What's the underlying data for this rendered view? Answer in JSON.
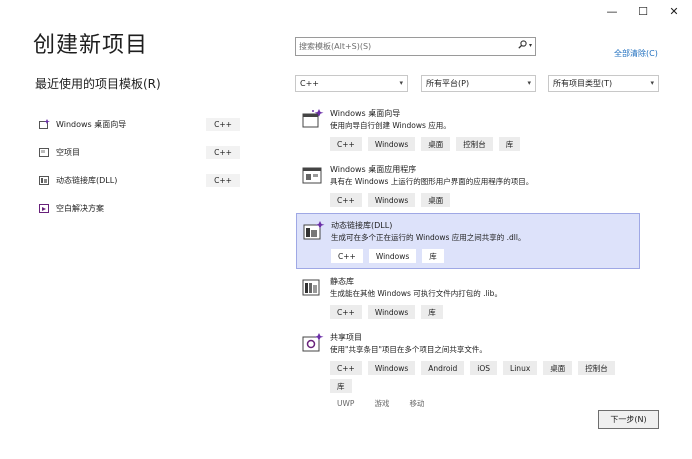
{
  "window": {
    "minimize": "—",
    "maximize": "☐",
    "close": "✕"
  },
  "page_title": "创建新项目",
  "recent": {
    "title": "最近使用的项目模板(R)",
    "items": [
      {
        "label": "Windows 桌面向导",
        "lang": "C++",
        "icon": "wizard-icon"
      },
      {
        "label": "空项目",
        "lang": "C++",
        "icon": "empty-project-icon"
      },
      {
        "label": "动态链接库(DLL)",
        "lang": "C++",
        "icon": "dll-icon"
      },
      {
        "label": "空白解决方案",
        "lang": "",
        "icon": "solution-icon"
      }
    ]
  },
  "search": {
    "placeholder": "搜索模板(Alt+S)(S)"
  },
  "clear_all": "全部清除(C)",
  "filters": {
    "language": "C++",
    "platform": "所有平台(P)",
    "project_type": "所有项目类型(T)"
  },
  "templates": [
    {
      "name": "Windows 桌面向导",
      "desc": "使用向导自行创建 Windows 应用。",
      "tags": [
        "C++",
        "Windows",
        "桌面",
        "控制台",
        "库"
      ],
      "tags2": []
    },
    {
      "name": "Windows 桌面应用程序",
      "desc": "具有在 Windows 上运行的图形用户界面的应用程序的项目。",
      "tags": [
        "C++",
        "Windows",
        "桌面"
      ],
      "tags2": []
    },
    {
      "name": "动态链接库(DLL)",
      "desc": "生成可在多个正在运行的 Windows 应用之间共享的 .dll。",
      "tags": [
        "C++",
        "Windows",
        "库"
      ],
      "tags2": []
    },
    {
      "name": "静态库",
      "desc": "生成能在其他 Windows 可执行文件内打包的 .lib。",
      "tags": [
        "C++",
        "Windows",
        "库"
      ],
      "tags2": []
    },
    {
      "name": "共享项目",
      "desc": "使用\"共享条目\"项目在多个项目之间共享文件。",
      "tags": [
        "C++",
        "Windows",
        "Android",
        "iOS",
        "Linux",
        "桌面",
        "控制台",
        "库"
      ],
      "tags2": [
        "UWP",
        "游戏",
        "移动"
      ]
    }
  ],
  "next_button": "下一步(N)",
  "colors": {
    "accent": "#1f6fbf",
    "selected_bg": "#dde2fa",
    "selected_border": "#9fa8e5"
  }
}
